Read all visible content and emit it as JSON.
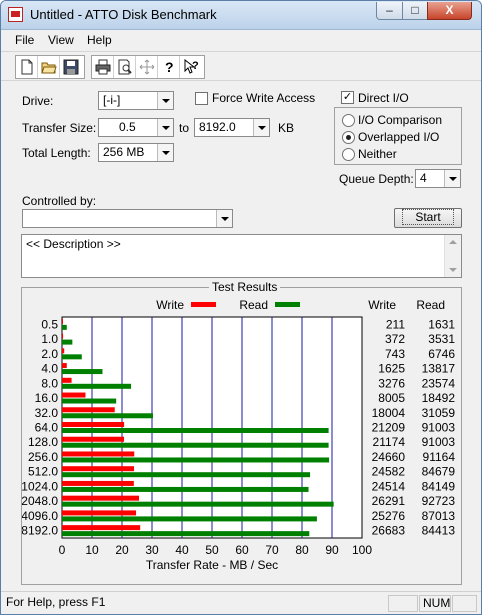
{
  "window": {
    "title": "Untitled - ATTO Disk Benchmark",
    "min_glyph": "–",
    "max_glyph": "□",
    "close_glyph": "X"
  },
  "menu": [
    "File",
    "View",
    "Help"
  ],
  "toolbar_icons": [
    "new-file-icon",
    "open-folder-icon",
    "save-icon",
    "print-icon",
    "print-preview-icon",
    "move-icon",
    "help-icon",
    "context-help-icon"
  ],
  "form": {
    "drive_label": "Drive:",
    "drive_value": "[-i-]",
    "force_write_label": "Force Write Access",
    "force_write_checked": false,
    "direct_io_label": "Direct I/O",
    "direct_io_checked": true,
    "transfer_size_label": "Transfer Size:",
    "transfer_from": "0.5",
    "to_label": "to",
    "transfer_to": "8192.0",
    "kb_label": "KB",
    "total_length_label": "Total Length:",
    "total_length_value": "256 MB",
    "io_mode_options": [
      "I/O Comparison",
      "Overlapped I/O",
      "Neither"
    ],
    "io_mode_selected": "Overlapped I/O",
    "queue_depth_label": "Queue Depth:",
    "queue_depth_value": "4",
    "controlled_by_label": "Controlled by:",
    "controlled_by_value": "",
    "start_label": "Start",
    "description_text": "<< Description >>"
  },
  "results": {
    "title": "Test Results",
    "legend_write": "Write",
    "legend_read": "Read",
    "col_write": "Write",
    "col_read": "Read",
    "write_color": "#ff0000",
    "read_color": "#008000"
  },
  "chart_data": {
    "type": "bar",
    "orientation": "horizontal",
    "title": "Test Results",
    "xlabel": "Transfer Rate - MB / Sec",
    "xlim": [
      0,
      100
    ],
    "xticks": [
      0,
      10,
      20,
      30,
      40,
      50,
      60,
      70,
      80,
      90,
      100
    ],
    "categories": [
      "0.5",
      "1.0",
      "2.0",
      "4.0",
      "8.0",
      "16.0",
      "32.0",
      "64.0",
      "128.0",
      "256.0",
      "512.0",
      "1024.0",
      "2048.0",
      "4096.0",
      "8192.0"
    ],
    "series": [
      {
        "name": "Write",
        "color": "#ff0000",
        "values": [
          0.2,
          0.36,
          0.73,
          1.59,
          3.2,
          7.82,
          17.58,
          20.71,
          20.68,
          24.08,
          24.01,
          23.94,
          25.67,
          24.68,
          26.06
        ]
      },
      {
        "name": "Read",
        "color": "#008000",
        "values": [
          1.59,
          3.45,
          6.59,
          13.49,
          23.02,
          18.06,
          30.33,
          88.87,
          88.87,
          89.03,
          82.69,
          82.18,
          90.55,
          84.97,
          82.43
        ]
      }
    ],
    "write_numbers": [
      "211",
      "372",
      "743",
      "1625",
      "3276",
      "8005",
      "18004",
      "21209",
      "21174",
      "24660",
      "24582",
      "24514",
      "26291",
      "25276",
      "26683"
    ],
    "read_numbers": [
      "1631",
      "3531",
      "6746",
      "13817",
      "23574",
      "18492",
      "31059",
      "91003",
      "91003",
      "91164",
      "84679",
      "84149",
      "92723",
      "87013",
      "84413"
    ],
    "grid": true,
    "legend_placement": "top-center"
  },
  "status": {
    "help_text": "For Help, press F1",
    "num_label": "NUM"
  }
}
